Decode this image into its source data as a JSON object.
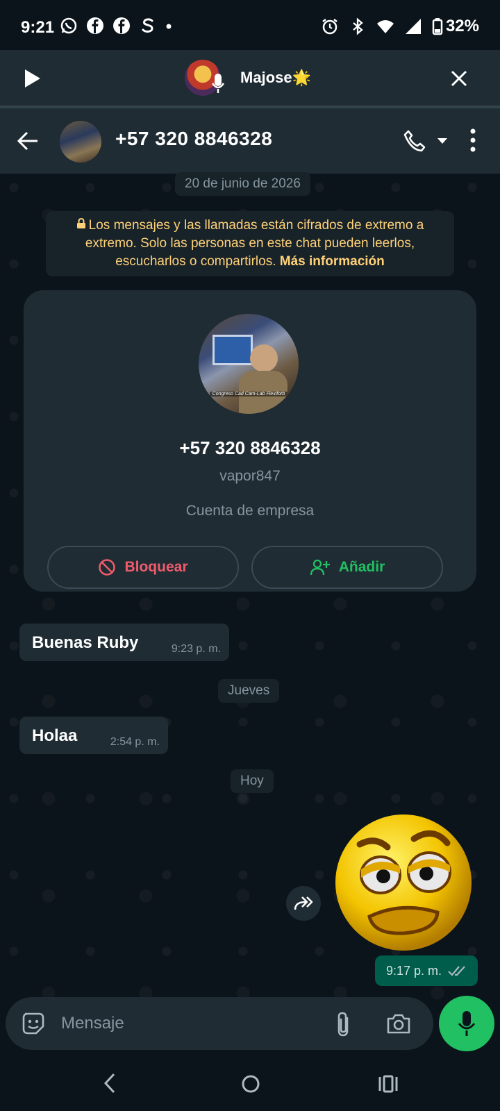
{
  "status_bar": {
    "time": "9:21",
    "battery": "32%"
  },
  "call_bar": {
    "caller_name": "Majose",
    "name_emoji": "🌟"
  },
  "header": {
    "contact_name": "+57 320 8846328"
  },
  "chat": {
    "date_first": "20 de junio de 2026",
    "encryption_notice": "Los mensajes y las llamadas están cifrados de extremo a extremo. Solo las personas en este chat pueden leerlos, escucharlos o compartirlos.",
    "encryption_link": "Más información",
    "contact_card": {
      "phone": "+57 320 8846328",
      "username": "vapor847",
      "account_type": "Cuenta de empresa",
      "block_label": "Bloquear",
      "add_label": "Añadir",
      "avatar_caption": "Congreso Cad Cam-Lab Flexiforb"
    },
    "messages": [
      {
        "text": "Buenas Ruby",
        "time": "9:23 p. m."
      },
      {
        "separator": "Jueves"
      },
      {
        "text": "Holaa",
        "time": "2:54 p. m."
      },
      {
        "separator": "Hoy"
      }
    ],
    "sticker_time": "9:17 p. m."
  },
  "input": {
    "placeholder": "Mensaje"
  },
  "colors": {
    "accent_green": "#21c063",
    "block_red": "#f15c6d",
    "add_green": "#21c063",
    "notice_yellow": "#ffd279"
  }
}
